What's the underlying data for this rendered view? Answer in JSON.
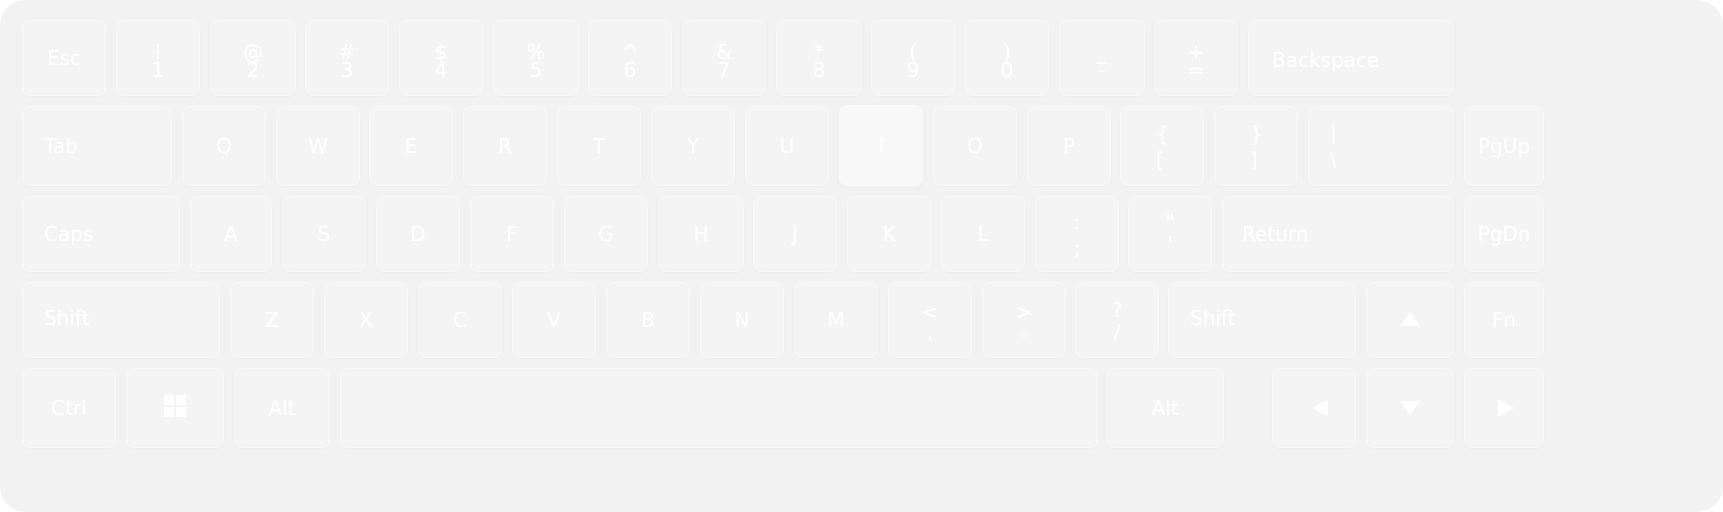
{
  "keyboard": {
    "row1": {
      "esc": "Esc",
      "k1": {
        "top": "!",
        "bottom": "1"
      },
      "k2": {
        "top": "@",
        "bottom": "2"
      },
      "k3": {
        "top": "#",
        "bottom": "3"
      },
      "k4": {
        "top": "$",
        "bottom": "4"
      },
      "k5": {
        "top": "%",
        "bottom": "5"
      },
      "k6": {
        "top": "^",
        "bottom": "6"
      },
      "k7": {
        "top": "&",
        "bottom": "7"
      },
      "k8": {
        "top": "*",
        "bottom": "8"
      },
      "k9": {
        "top": "(",
        "bottom": "9"
      },
      "k0": {
        "top": ")",
        "bottom": "0"
      },
      "minus": {
        "top": "_",
        "bottom": "-"
      },
      "equal": {
        "top": "+",
        "bottom": "="
      },
      "backspace": "Backspace"
    },
    "row2": {
      "tab": "Tab",
      "q": "Q",
      "w": "W",
      "e": "E",
      "r": "R",
      "t": "T",
      "y": "Y",
      "u": "U",
      "i": "I",
      "o": "O",
      "p": "P",
      "lbracket": {
        "top": "{",
        "bottom": "["
      },
      "rbracket": {
        "top": "}",
        "bottom": "]"
      },
      "backslash": {
        "top": "|",
        "bottom": "\\"
      },
      "pgup": "PgUp"
    },
    "row3": {
      "caps": "Caps",
      "a": "A",
      "s": "S",
      "d": "D",
      "f": "F",
      "g": "G",
      "h": "H",
      "j": "J",
      "k": "K",
      "l": "L",
      "semicolon": {
        "top": ":",
        "bottom": ";"
      },
      "quote": {
        "top": "\"",
        "bottom": "'"
      },
      "return": "Return",
      "pgdn": "PgDn"
    },
    "row4": {
      "shift_left": "Shift",
      "z": "Z",
      "x": "X",
      "c": "C",
      "v": "V",
      "b": "B",
      "n": "N",
      "m": "M",
      "comma": {
        "top": "<",
        "bottom": ","
      },
      "period": {
        "top": ">",
        "bottom": "."
      },
      "slash": {
        "top": "?",
        "bottom": "/"
      },
      "shift_right": "Shift",
      "fn": "Fn"
    },
    "row5": {
      "ctrl": "Ctrl",
      "alt_left": "Alt",
      "alt_right": "Alt"
    },
    "icons": {
      "windows": "windows-icon",
      "up": "arrow-up-icon",
      "down": "arrow-down-icon",
      "left": "arrow-left-icon",
      "right": "arrow-right-icon"
    },
    "highlighted_key": "I"
  }
}
